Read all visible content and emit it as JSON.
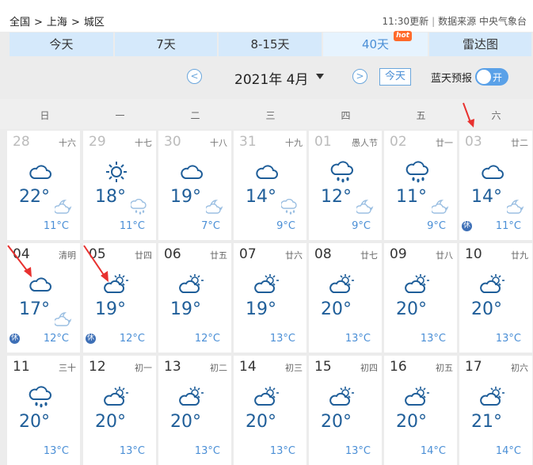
{
  "breadcrumb": [
    "全国",
    "上海",
    "城区"
  ],
  "breadcrumb_sep": ">",
  "update_time": "11:30更新",
  "source": "数据来源 中央气象台",
  "tabs": [
    {
      "label": "今天",
      "active": false
    },
    {
      "label": "7天",
      "active": false
    },
    {
      "label": "8-15天",
      "active": false
    },
    {
      "label": "40天",
      "active": true,
      "badge": "hot"
    },
    {
      "label": "雷达图",
      "active": false
    }
  ],
  "month_nav": {
    "prev": "<",
    "next": ">",
    "month_label": "2021年 4月",
    "today": "今天",
    "bluesky": "蓝天预报",
    "toggle_label": "开"
  },
  "weekdays": [
    "日",
    "一",
    "二",
    "三",
    "四",
    "五",
    "六"
  ],
  "rest_label": "休",
  "days": [
    {
      "day": "28",
      "lunar": "十六",
      "icon": "cloudy",
      "high": "22°",
      "low": "11°C",
      "small_icon": "night-cloudy",
      "past": true,
      "rest": false
    },
    {
      "day": "29",
      "lunar": "十七",
      "icon": "sunny",
      "high": "18°",
      "low": "11°C",
      "small_icon": "rain",
      "past": true,
      "rest": false
    },
    {
      "day": "30",
      "lunar": "十八",
      "icon": "cloudy",
      "high": "19°",
      "low": "7°C",
      "small_icon": "night-cloudy",
      "past": true,
      "rest": false
    },
    {
      "day": "31",
      "lunar": "十九",
      "icon": "cloudy",
      "high": "14°",
      "low": "9°C",
      "small_icon": "rain",
      "past": true,
      "rest": false
    },
    {
      "day": "01",
      "lunar": "愚人节",
      "icon": "rain",
      "high": "12°",
      "low": "9°C",
      "small_icon": "night-cloudy",
      "past": true,
      "rest": false
    },
    {
      "day": "02",
      "lunar": "廿一",
      "icon": "rain",
      "high": "11°",
      "low": "9°C",
      "small_icon": "night-cloudy",
      "past": true,
      "rest": false
    },
    {
      "day": "03",
      "lunar": "廿二",
      "icon": "cloudy",
      "high": "14°",
      "low": "11°C",
      "small_icon": "night-cloudy",
      "past": true,
      "rest": true
    },
    {
      "day": "04",
      "lunar": "清明",
      "icon": "cloudy",
      "high": "17°",
      "low": "12°C",
      "small_icon": "night-cloudy",
      "past": false,
      "rest": true
    },
    {
      "day": "05",
      "lunar": "廿四",
      "icon": "partly-cloudy",
      "high": "19°",
      "low": "12°C",
      "small_icon": "none",
      "past": false,
      "rest": true
    },
    {
      "day": "06",
      "lunar": "廿五",
      "icon": "partly-cloudy",
      "high": "19°",
      "low": "12°C",
      "small_icon": "none",
      "past": false,
      "rest": false
    },
    {
      "day": "07",
      "lunar": "廿六",
      "icon": "partly-cloudy",
      "high": "19°",
      "low": "13°C",
      "small_icon": "none",
      "past": false,
      "rest": false
    },
    {
      "day": "08",
      "lunar": "廿七",
      "icon": "partly-cloudy",
      "high": "20°",
      "low": "13°C",
      "small_icon": "none",
      "past": false,
      "rest": false
    },
    {
      "day": "09",
      "lunar": "廿八",
      "icon": "partly-cloudy",
      "high": "20°",
      "low": "13°C",
      "small_icon": "none",
      "past": false,
      "rest": false
    },
    {
      "day": "10",
      "lunar": "廿九",
      "icon": "partly-cloudy",
      "high": "20°",
      "low": "13°C",
      "small_icon": "none",
      "past": false,
      "rest": false
    },
    {
      "day": "11",
      "lunar": "三十",
      "icon": "rain",
      "high": "20°",
      "low": "13°C",
      "small_icon": "none",
      "past": false,
      "rest": false
    },
    {
      "day": "12",
      "lunar": "初一",
      "icon": "partly-cloudy",
      "high": "20°",
      "low": "13°C",
      "small_icon": "none",
      "past": false,
      "rest": false
    },
    {
      "day": "13",
      "lunar": "初二",
      "icon": "partly-cloudy",
      "high": "20°",
      "low": "13°C",
      "small_icon": "none",
      "past": false,
      "rest": false
    },
    {
      "day": "14",
      "lunar": "初三",
      "icon": "partly-cloudy",
      "high": "20°",
      "low": "13°C",
      "small_icon": "none",
      "past": false,
      "rest": false
    },
    {
      "day": "15",
      "lunar": "初四",
      "icon": "partly-cloudy",
      "high": "20°",
      "low": "13°C",
      "small_icon": "none",
      "past": false,
      "rest": false
    },
    {
      "day": "16",
      "lunar": "初五",
      "icon": "partly-cloudy",
      "high": "20°",
      "low": "14°C",
      "small_icon": "none",
      "past": false,
      "rest": false
    },
    {
      "day": "17",
      "lunar": "初六",
      "icon": "partly-cloudy",
      "high": "21°",
      "low": "14°C",
      "small_icon": "none",
      "past": false,
      "rest": false
    }
  ],
  "colors": {
    "accent": "#4b8fd6",
    "tab_bg": "#d5e9fb",
    "temp_high": "#1f5e99",
    "annotation_arrow": "#e8312f",
    "rest_badge": "#3d6fb6"
  }
}
